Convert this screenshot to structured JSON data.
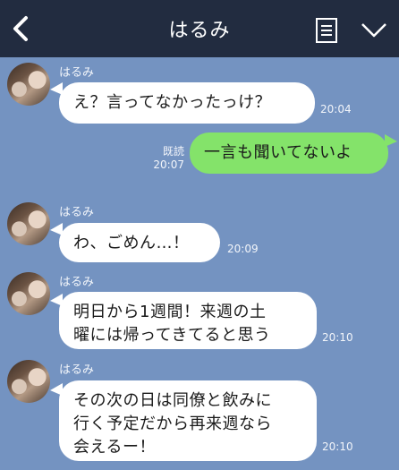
{
  "header": {
    "title": "はるみ",
    "back_icon": "chevron-left-icon",
    "menu_icon": "note-menu-icon",
    "more_icon": "chevron-down-icon",
    "bg_color": "#222c40"
  },
  "chat": {
    "bg_color": "#7493c1",
    "messages": [
      {
        "sender": "はるみ",
        "text": "え？言ってなかったっけ？",
        "time": "20:04"
      },
      {
        "sender": "me",
        "read": "既読",
        "text": "一言も聞いてないよ",
        "time": "20:07"
      },
      {
        "sender": "はるみ",
        "text": "わ、ごめん…！",
        "time": "20:09"
      },
      {
        "sender": "はるみ",
        "lines": [
          "明日から1週間！来週の土",
          "曜には帰ってきてると思う"
        ],
        "time": "20:10"
      },
      {
        "sender": "はるみ",
        "lines": [
          "その次の日は同僚と飲みに",
          "行く予定だから再来週なら",
          "会えるー！"
        ],
        "time": "20:10"
      }
    ]
  }
}
